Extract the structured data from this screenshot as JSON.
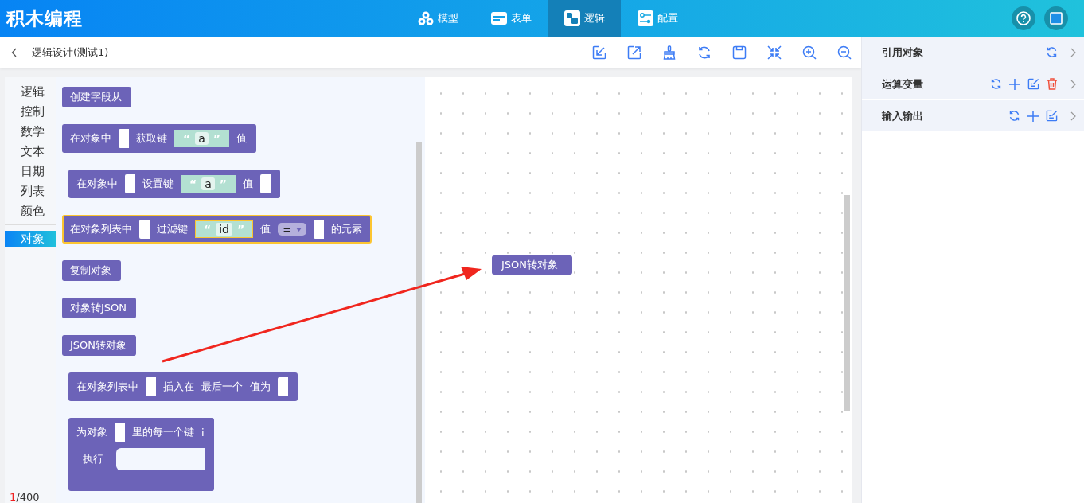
{
  "app_title": "积木编程",
  "nav_tabs": [
    {
      "label": "模型",
      "selected": false,
      "kind": "model"
    },
    {
      "label": "表单",
      "selected": false,
      "kind": "form"
    },
    {
      "label": "逻辑",
      "selected": true,
      "kind": "logic"
    },
    {
      "label": "配置",
      "selected": false,
      "kind": "config"
    }
  ],
  "page_title": "逻辑设计(测试1)",
  "categories": [
    {
      "label": "逻辑",
      "selected": false
    },
    {
      "label": "控制",
      "selected": false
    },
    {
      "label": "数学",
      "selected": false
    },
    {
      "label": "文本",
      "selected": false
    },
    {
      "label": "日期",
      "selected": false
    },
    {
      "label": "列表",
      "selected": false
    },
    {
      "label": "颜色",
      "selected": false
    },
    {
      "label": "对象",
      "selected": true
    }
  ],
  "blocks": [
    {
      "kind": "value",
      "selected": false,
      "rows": [
        [
          {
            "kind": "text",
            "text": "创建字段从"
          }
        ]
      ]
    },
    {
      "kind": "value",
      "selected": false,
      "rows": [
        [
          {
            "kind": "text",
            "text": "在对象中"
          },
          {
            "kind": "slot"
          },
          {
            "kind": "text",
            "text": "获取键"
          },
          {
            "kind": "string",
            "open": "“",
            "value": "a",
            "close": "”"
          },
          {
            "kind": "text",
            "text": "值"
          }
        ]
      ]
    },
    {
      "kind": "statement",
      "selected": false,
      "rows": [
        [
          {
            "kind": "text",
            "text": "在对象中"
          },
          {
            "kind": "slot"
          },
          {
            "kind": "text",
            "text": "设置键"
          },
          {
            "kind": "string",
            "open": "“",
            "value": "a",
            "close": "”"
          },
          {
            "kind": "text",
            "text": "值"
          },
          {
            "kind": "slot"
          }
        ]
      ]
    },
    {
      "kind": "value",
      "selected": true,
      "rows": [
        [
          {
            "kind": "text",
            "text": "在对象列表中"
          },
          {
            "kind": "slot"
          },
          {
            "kind": "text",
            "text": "过滤键"
          },
          {
            "kind": "string",
            "open": "“",
            "value": "id",
            "close": "”"
          },
          {
            "kind": "text",
            "text": "值"
          },
          {
            "kind": "dropdown",
            "value": "="
          },
          {
            "kind": "slot"
          },
          {
            "kind": "text",
            "text": "的元素"
          }
        ]
      ]
    },
    {
      "kind": "value",
      "selected": false,
      "rows": [
        [
          {
            "kind": "text",
            "text": "复制对象"
          }
        ]
      ]
    },
    {
      "kind": "value",
      "selected": false,
      "rows": [
        [
          {
            "kind": "text",
            "text": "对象转JSON"
          }
        ]
      ]
    },
    {
      "kind": "value",
      "selected": false,
      "rows": [
        [
          {
            "kind": "text",
            "text": "JSON转对象"
          }
        ]
      ]
    },
    {
      "kind": "statement",
      "selected": false,
      "rows": [
        [
          {
            "kind": "text",
            "text": "在对象列表中"
          },
          {
            "kind": "slot"
          },
          {
            "kind": "text",
            "text": "插入在"
          },
          {
            "kind": "text",
            "text": "最后一个"
          },
          {
            "kind": "text",
            "text": "值为"
          },
          {
            "kind": "slot"
          }
        ]
      ]
    },
    {
      "kind": "c",
      "selected": false,
      "rows": [
        [
          {
            "kind": "text",
            "text": "为对象"
          },
          {
            "kind": "slot"
          },
          {
            "kind": "text",
            "text": "里的每一个键"
          },
          {
            "kind": "text",
            "text": "i"
          }
        ],
        [
          {
            "kind": "text",
            "text": "执行"
          }
        ]
      ]
    }
  ],
  "counter": {
    "current": "1",
    "total": "/400"
  },
  "canvas_block": {
    "label": "JSON转对象"
  },
  "panels": [
    {
      "title": "引用对象"
    },
    {
      "title": "运算变量"
    },
    {
      "title": "输入输出"
    }
  ]
}
